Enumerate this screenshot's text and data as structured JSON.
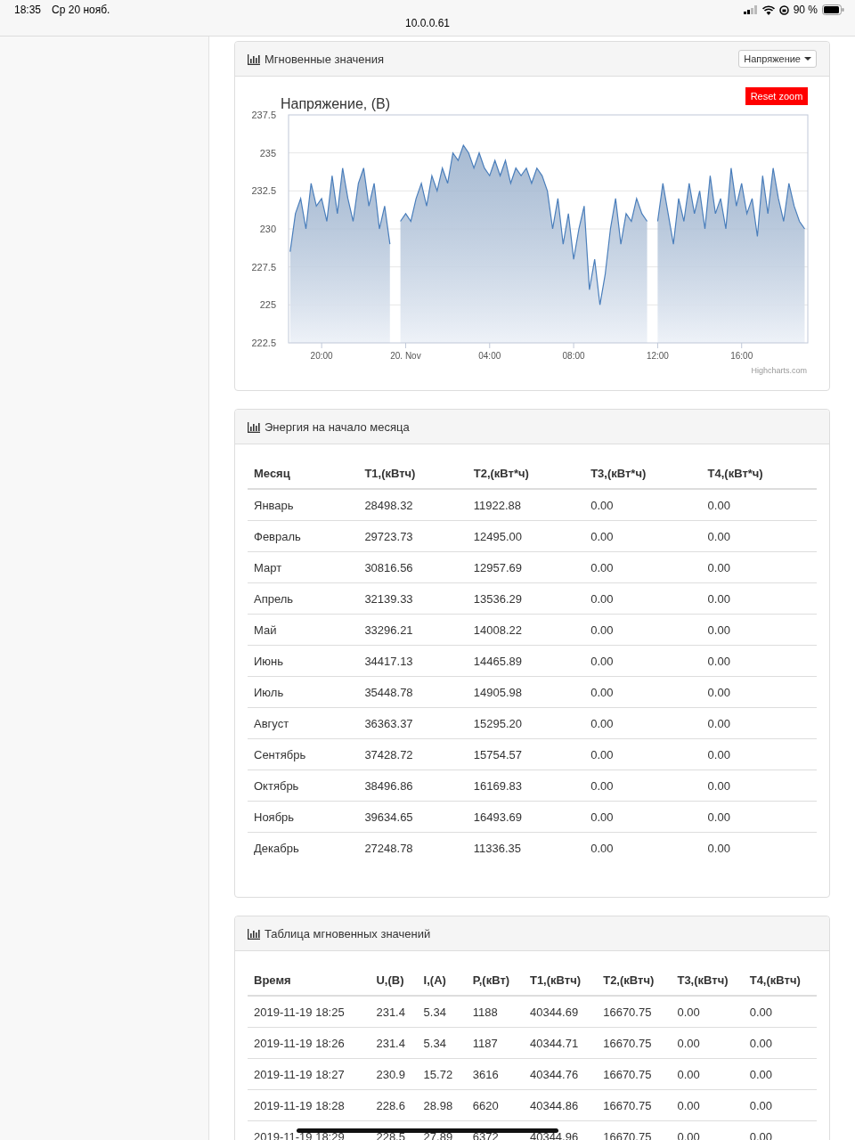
{
  "status_bar": {
    "time": "18:35",
    "date": "Ср 20 нояб.",
    "url": "10.0.0.61",
    "battery": "90 %"
  },
  "instant_panel": {
    "title": "Мгновенные значения",
    "selector": "Напряжение",
    "chart": {
      "reset_button": "Reset zoom",
      "credit": "Highcharts.com",
      "chart_data": {
        "type": "area",
        "title": "Напряжение, (В)",
        "categories": [
          null,
          null,
          null,
          null,
          null,
          null,
          "20:00",
          null,
          null,
          null,
          null,
          null,
          null,
          null,
          null,
          null,
          null,
          null,
          null,
          null,
          null,
          null,
          "20. Nov",
          null,
          null,
          null,
          null,
          null,
          null,
          null,
          null,
          null,
          null,
          null,
          null,
          null,
          null,
          null,
          "04:00",
          null,
          null,
          null,
          null,
          null,
          null,
          null,
          null,
          null,
          null,
          null,
          null,
          null,
          null,
          null,
          "08:00",
          null,
          null,
          null,
          null,
          null,
          null,
          null,
          null,
          null,
          null,
          null,
          null,
          null,
          null,
          null,
          "12:00",
          null,
          null,
          null,
          null,
          null,
          null,
          null,
          null,
          null,
          null,
          null,
          null,
          null,
          null,
          null,
          "16:00",
          null,
          null,
          null,
          null,
          null,
          null,
          null,
          null,
          null,
          null,
          null,
          null
        ],
        "series": [
          {
            "color": "#4a7ebb",
            "values": [
              228.5,
              231,
              232,
              230,
              233,
              231.5,
              232,
              230.5,
              233.5,
              231,
              234,
              232,
              230.5,
              233,
              234,
              231.5,
              233,
              230,
              231.5,
              229,
              null,
              230.5,
              231,
              230.5,
              232,
              233,
              231.5,
              233.5,
              232.5,
              234,
              233,
              235,
              234.5,
              235.5,
              235,
              234,
              235,
              234,
              233.5,
              234.5,
              233.5,
              234.5,
              233,
              234,
              233.5,
              234,
              233,
              234,
              233.5,
              232.5,
              230,
              232,
              229,
              231,
              228,
              230,
              231.5,
              226,
              228,
              225,
              227,
              230,
              232,
              229,
              231,
              230.5,
              232,
              231,
              230.5,
              null,
              230.5,
              233,
              231,
              229,
              232,
              230.5,
              233,
              231,
              232.5,
              230,
              233.5,
              231,
              232,
              230,
              234,
              231.5,
              233,
              231,
              232,
              229.5,
              233.5,
              231,
              234,
              232,
              230.5,
              233,
              231.5,
              230.5,
              230
            ]
          }
        ],
        "ylim": [
          222.5,
          237.5
        ],
        "grid": true,
        "yticks": [
          237.5,
          235,
          232.5,
          230,
          227.5,
          225,
          222.5
        ]
      }
    }
  },
  "energy_panel": {
    "title": "Энергия на начало месяца",
    "columns": [
      "Месяц",
      "T1,(кВтч)",
      "T2,(кВт*ч)",
      "T3,(кВт*ч)",
      "T4,(кВт*ч)"
    ],
    "rows": [
      [
        "Январь",
        "28498.32",
        "11922.88",
        "0.00",
        "0.00"
      ],
      [
        "Февраль",
        "29723.73",
        "12495.00",
        "0.00",
        "0.00"
      ],
      [
        "Март",
        "30816.56",
        "12957.69",
        "0.00",
        "0.00"
      ],
      [
        "Апрель",
        "32139.33",
        "13536.29",
        "0.00",
        "0.00"
      ],
      [
        "Май",
        "33296.21",
        "14008.22",
        "0.00",
        "0.00"
      ],
      [
        "Июнь",
        "34417.13",
        "14465.89",
        "0.00",
        "0.00"
      ],
      [
        "Июль",
        "35448.78",
        "14905.98",
        "0.00",
        "0.00"
      ],
      [
        "Август",
        "36363.37",
        "15295.20",
        "0.00",
        "0.00"
      ],
      [
        "Сентябрь",
        "37428.72",
        "15754.57",
        "0.00",
        "0.00"
      ],
      [
        "Октябрь",
        "38496.86",
        "16169.83",
        "0.00",
        "0.00"
      ],
      [
        "Ноябрь",
        "39634.65",
        "16493.69",
        "0.00",
        "0.00"
      ],
      [
        "Декабрь",
        "27248.78",
        "11336.35",
        "0.00",
        "0.00"
      ]
    ]
  },
  "instant_table_panel": {
    "title": "Таблица мгновенных значений",
    "columns": [
      "Время",
      "U,(В)",
      "I,(А)",
      "P,(кВт)",
      "T1,(кВтч)",
      "T2,(кВтч)",
      "T3,(кВтч)",
      "T4,(кВтч)"
    ],
    "rows": [
      [
        "2019-11-19 18:25",
        "231.4",
        "5.34",
        "1188",
        "40344.69",
        "16670.75",
        "0.00",
        "0.00"
      ],
      [
        "2019-11-19 18:26",
        "231.4",
        "5.34",
        "1187",
        "40344.71",
        "16670.75",
        "0.00",
        "0.00"
      ],
      [
        "2019-11-19 18:27",
        "230.9",
        "15.72",
        "3616",
        "40344.76",
        "16670.75",
        "0.00",
        "0.00"
      ],
      [
        "2019-11-19 18:28",
        "228.6",
        "28.98",
        "6620",
        "40344.86",
        "16670.75",
        "0.00",
        "0.00"
      ],
      [
        "2019-11-19 18:29",
        "228.5",
        "27.89",
        "6372",
        "40344.96",
        "16670.75",
        "0.00",
        "0.00"
      ]
    ]
  }
}
